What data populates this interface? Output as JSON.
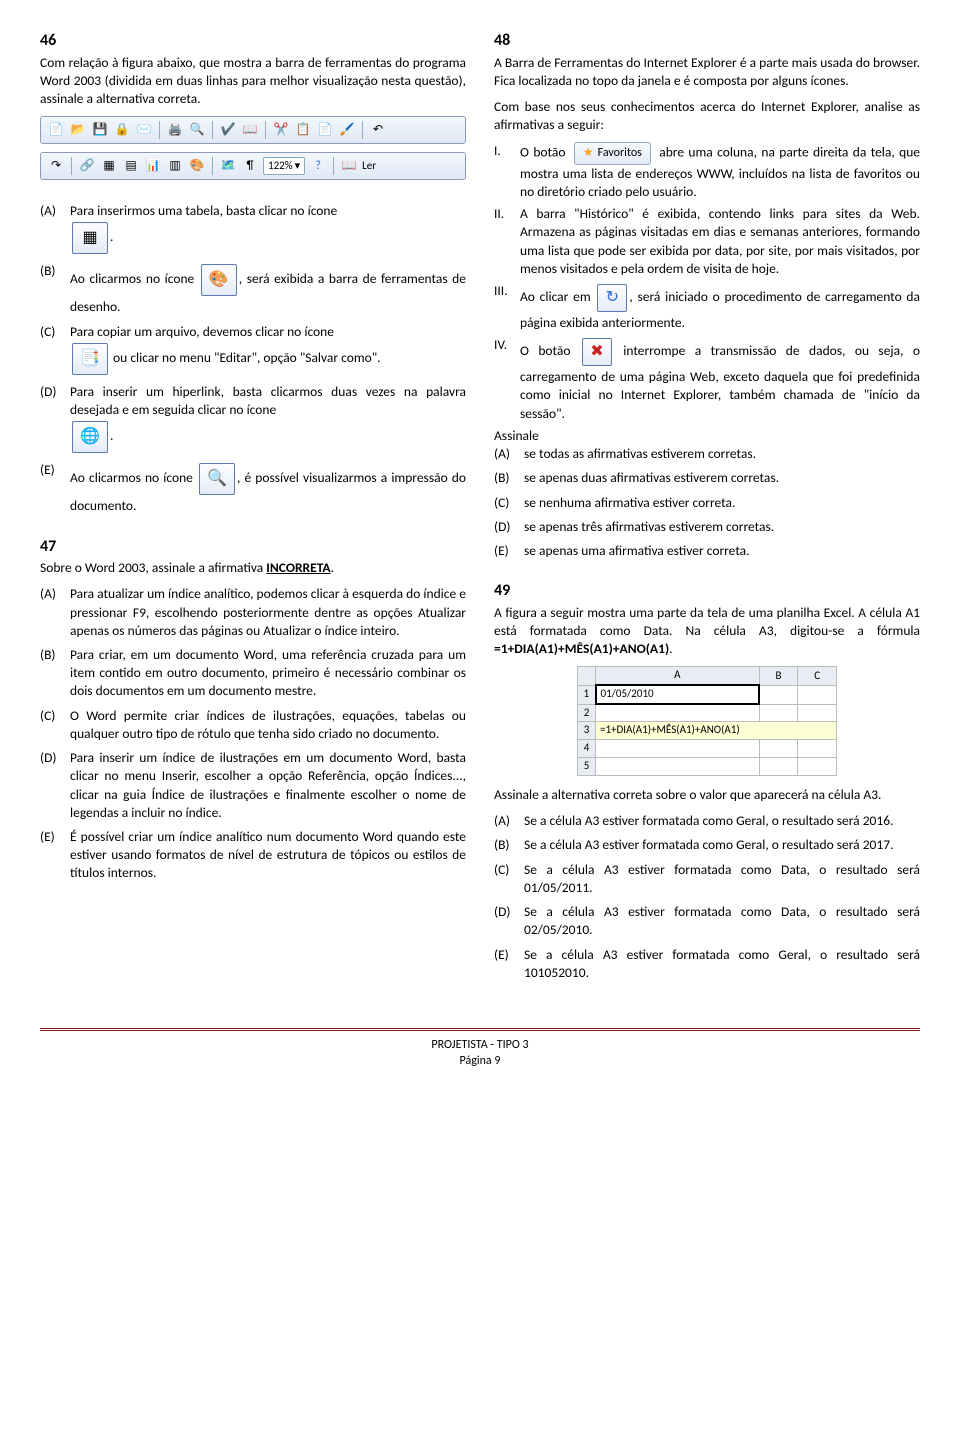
{
  "q46": {
    "num": "46",
    "text": "Com relação à figura abaixo, que mostra a barra de ferramentas do programa Word 2003 (dividida em duas linhas para melhor visualização nesta questão), assinale a alternativa correta.",
    "zoom": "122%",
    "A": "Para inserirmos uma tabela, basta clicar no ícone",
    "B1": "Ao clicarmos no ícone ",
    "B2": ", será exibida a barra de ferramentas de desenho.",
    "C1": "Para copiar um arquivo, devemos clicar no ícone",
    "C2": " ou clicar no menu \"Editar\", opção \"Salvar como\".",
    "D": "Para inserir um hiperlink, basta clicarmos duas vezes na palavra desejada e em seguida clicar no ícone",
    "E1": "Ao clicarmos no ícone ",
    "E2": ", é possível visualizarmos a impressão do documento."
  },
  "q47": {
    "num": "47",
    "intro1": "Sobre o Word 2003, assinale a afirmativa ",
    "intro2": "INCORRETA",
    "A": "Para atualizar um índice analítico, podemos clicar à esquerda do índice e pressionar F9, escolhendo posteriormente dentre as opções Atualizar apenas os números das páginas ou Atualizar o índice inteiro.",
    "B": "Para criar, em um documento Word, uma referência cruzada para um item contido em outro documento, primeiro é necessário combinar os dois documentos em um documento mestre.",
    "C": "O Word permite criar índices de ilustrações, equações, tabelas ou qualquer outro tipo de rótulo que tenha sido criado no documento.",
    "D": "Para inserir um índice de ilustrações em um documento Word, basta clicar no menu Inserir, escolher a opção Referência, opção Índices..., clicar na guia Índice de ilustrações e finalmente escolher o nome de legendas a incluir no índice.",
    "E": "É possível criar um índice analítico num documento Word quando este estiver usando formatos de nível de estrutura de tópicos ou estilos de títulos internos."
  },
  "q48": {
    "num": "48",
    "p1": "A Barra de Ferramentas do Internet Explorer é a parte mais usada do browser. Fica localizada no topo da janela e é composta por alguns ícones.",
    "p2": "Com base nos seus conhecimentos acerca do Internet Explorer, analise as afirmativas a seguir:",
    "fav": "Favoritos",
    "I1": "O botão ",
    "I2": " abre uma coluna, na parte direita da tela, que mostra uma lista de endereços WWW, incluídos na lista de favoritos ou no diretório criado pelo usuário.",
    "II": "A barra \"Histórico\" é exibida, contendo links para sites da Web. Armazena as páginas visitadas em dias e semanas anteriores, formando uma lista que pode ser exibida por data, por site, por mais visitados, por menos visitados e pela ordem de visita de hoje.",
    "III1": "Ao clicar em ",
    "III2": ", será iniciado o procedimento de carregamento da página exibida anteriormente.",
    "IV1": "O botão ",
    "IV2": " interrompe a transmissão de dados, ou seja, o carregamento de uma página Web, exceto daquela que foi predefinida como inicial no Internet Explorer, também chamada de \"início da sessão\".",
    "assinale": "Assinale",
    "A": "se todas as afirmativas estiverem corretas.",
    "B": "se apenas duas afirmativas estiverem corretas.",
    "C": "se nenhuma afirmativa estiver correta.",
    "D": "se apenas três afirmativas estiverem corretas.",
    "E": "se apenas uma afirmativa estiver correta."
  },
  "q49": {
    "num": "49",
    "p1": "A figura a seguir mostra uma parte da tela de uma planilha Excel. A célula A1 está formatada como Data. Na célula A3, digitou-se a fórmula ",
    "formula_bold": "=1+DIA(A1)+MÊS(A1)+ANO(A1)",
    "a1_val": "01/05/2010",
    "a3_val": "=1+DIA(A1)+MÊS(A1)+ANO(A1)",
    "colA": "A",
    "colB": "B",
    "colC": "C",
    "p2": "Assinale a alternativa correta sobre o valor que aparecerá na célula A3.",
    "A": "Se a célula A3 estiver formatada como Geral, o resultado será 2016.",
    "B": "Se a célula A3 estiver formatada como Geral, o resultado será 2017.",
    "C": "Se a célula A3 estiver formatada como Data, o resultado será 01/05/2011.",
    "D": "Se a célula A3 estiver formatada como Data, o resultado será 02/05/2010.",
    "E": "Se a célula A3 estiver formatada como Geral, o resultado será 101052010."
  },
  "footer": {
    "line1": "PROJETISTA - TIPO 3",
    "line2": "Página 9"
  }
}
